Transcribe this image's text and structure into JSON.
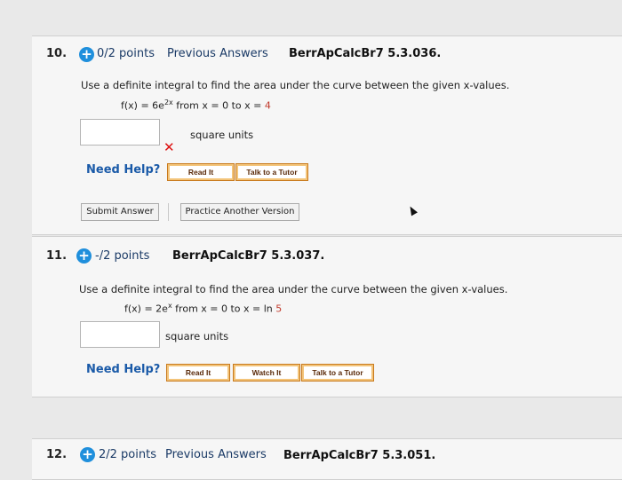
{
  "q10": {
    "number": "10.",
    "points": "0/2 points",
    "previous_answers": "Previous Answers",
    "ref": "BerrApCalcBr7 5.3.036.",
    "prompt": "Use a definite integral to find the area under the curve between the given x-values.",
    "func_lhs": "f(x) = 6e",
    "func_exp": "2x",
    "from_text": " from x = 0 to x = ",
    "to_value": "4",
    "units": "square units",
    "need_help": "Need Help?",
    "help_buttons": [
      "Read It",
      "Talk to a Tutor"
    ],
    "submit_label": "Submit Answer",
    "practice_label": "Practice Another Version"
  },
  "q11": {
    "number": "11.",
    "points": "-/2 points",
    "ref": "BerrApCalcBr7 5.3.037.",
    "prompt": "Use a definite integral to find the area under the curve between the given x-values.",
    "func_lhs": "f(x) = 2e",
    "func_exp": "x",
    "from_text": " from  x = 0  to  x = ln ",
    "to_value": "5",
    "units": "square units",
    "need_help": "Need Help?",
    "help_buttons": [
      "Read It",
      "Watch It",
      "Talk to a Tutor"
    ]
  },
  "q12": {
    "number": "12.",
    "points": "2/2 points",
    "previous_answers": "Previous Answers",
    "ref": "BerrApCalcBr7 5.3.051."
  },
  "colors": {
    "plus": "#1f8fdc",
    "points": "#1a3a66",
    "need_help": "#1a5aa8",
    "incorrect": "#d11111"
  }
}
